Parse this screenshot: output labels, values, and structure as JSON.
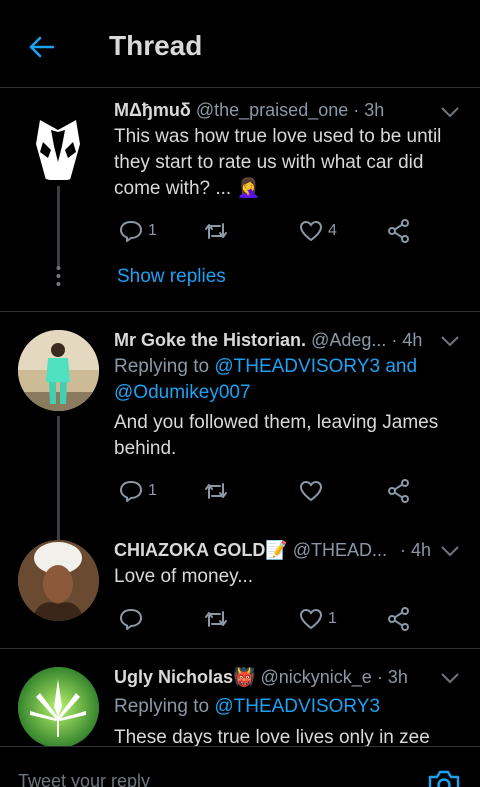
{
  "header": {
    "title": "Thread"
  },
  "tweets": [
    {
      "name": "MΔђmuδ",
      "handle": "@the_praised_one",
      "time": "· 3h",
      "text": "This was how true love used to be until they start to rate us with what car did come with? ... 🤦‍♀️",
      "replies": "1",
      "retweets": "",
      "likes": "4",
      "show_replies": "Show replies"
    },
    {
      "name": "Mr Goke the Historian.",
      "handle": "@Adeg...",
      "time": "· 4h",
      "replying_prefix": "Replying to ",
      "replying_to": "@THEADVISORY3 and @Odumikey007",
      "text": "And you followed them, leaving James behind.",
      "replies": "1",
      "retweets": "",
      "likes": ""
    },
    {
      "name": "CHIAZOKA GOLD📝",
      "handle": "@THEAD...",
      "time": "· 4h",
      "text": "Love of money...",
      "replies": "",
      "retweets": "",
      "likes": "1"
    },
    {
      "name": "Ugly Nicholas👹",
      "handle": "@nickynick_e",
      "time": "· 3h",
      "replying_prefix": "Replying to ",
      "replying_to": "@THEADVISORY3",
      "text": "These days true love lives only in zee"
    }
  ],
  "reply_bar": {
    "placeholder": "Tweet your reply"
  },
  "colors": {
    "accent": "#1da1f2",
    "background": "#000000",
    "text": "#d9d9d9",
    "muted": "#8b98a5",
    "divider": "#2f3336"
  }
}
